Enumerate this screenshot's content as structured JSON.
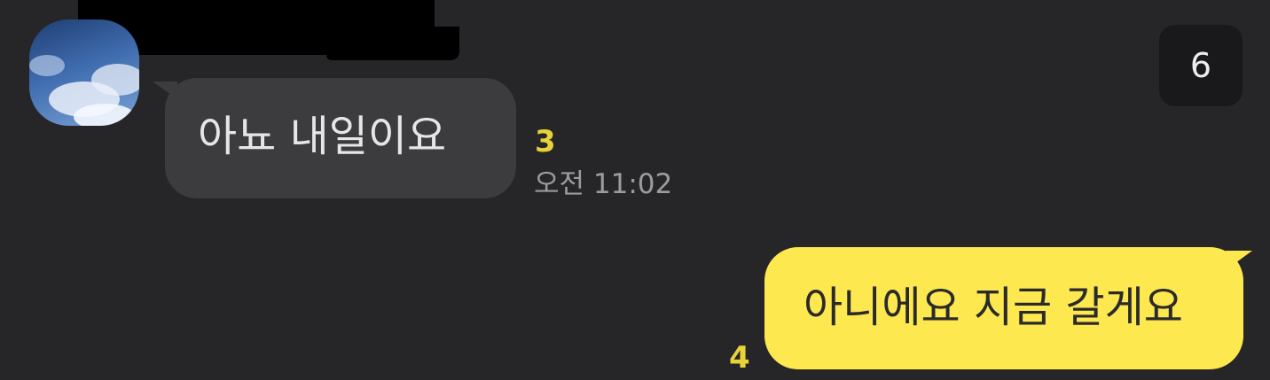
{
  "incoming_message": {
    "text": "아뇨 내일이요",
    "unread_count": "3",
    "timestamp": "오전 11:02"
  },
  "outgoing_message": {
    "text": "아니에요 지금 갈게요",
    "unread_count": "4"
  },
  "corner_badge": {
    "count": "6"
  },
  "colors": {
    "background": "#262628",
    "incoming_bubble": "#3c3c3e",
    "outgoing_bubble": "#fde84f",
    "unread_count": "#e7d23a"
  },
  "icons": {
    "avatar": "sky-clouds-profile-avatar"
  }
}
